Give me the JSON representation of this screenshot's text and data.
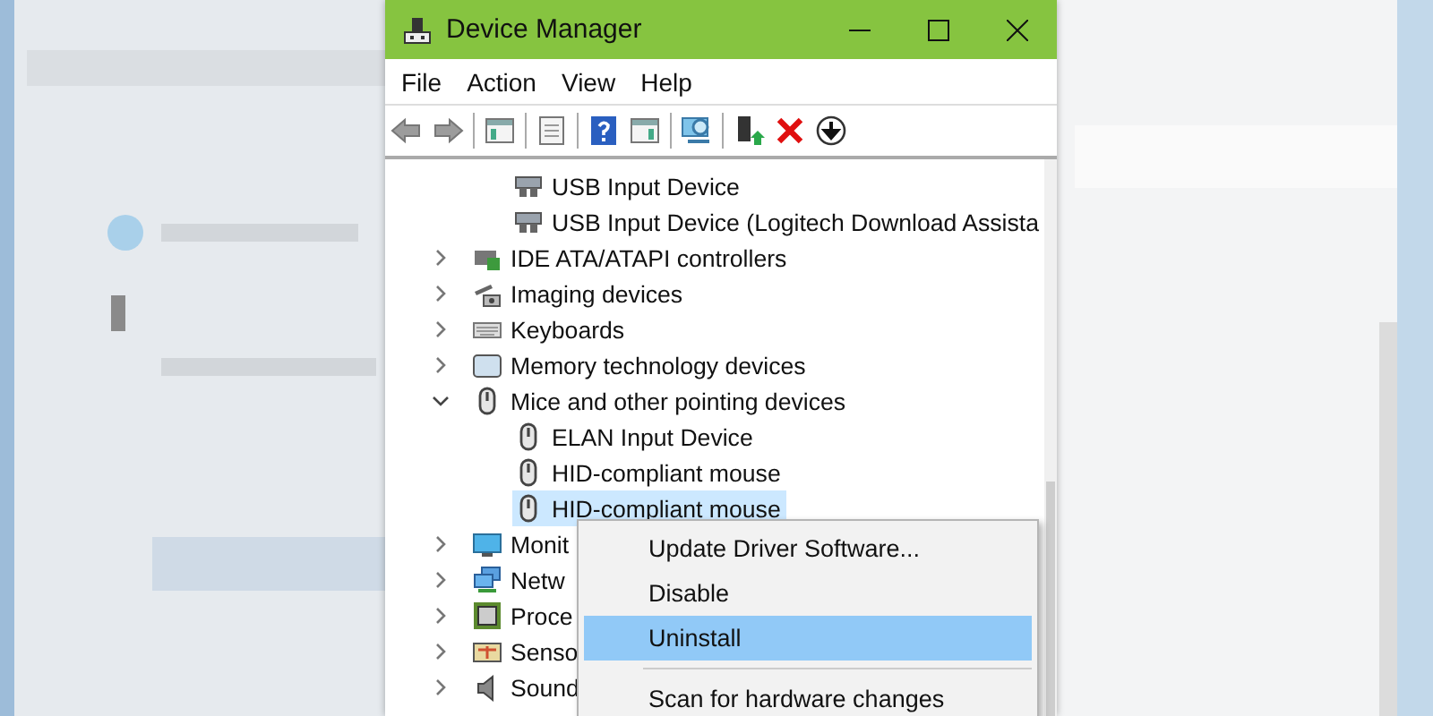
{
  "window": {
    "title": "Device Manager"
  },
  "menu": [
    "File",
    "Action",
    "View",
    "Help"
  ],
  "toolbar": [
    {
      "kind": "back"
    },
    {
      "kind": "forward"
    },
    {
      "kind": "separator"
    },
    {
      "kind": "console"
    },
    {
      "kind": "separator"
    },
    {
      "kind": "properties"
    },
    {
      "kind": "separator"
    },
    {
      "kind": "help"
    },
    {
      "kind": "action_pane"
    },
    {
      "kind": "separator"
    },
    {
      "kind": "scan"
    },
    {
      "kind": "separator"
    },
    {
      "kind": "enable"
    },
    {
      "kind": "uninstall"
    },
    {
      "kind": "update"
    }
  ],
  "tree": {
    "visible_children": [
      {
        "label": "USB Input Device",
        "kind": "usb_keyboard",
        "selected": false
      },
      {
        "label": "USB Input Device (Logitech Download Assista",
        "kind": "usb_keyboard",
        "selected": false
      }
    ],
    "items": [
      {
        "label": "IDE ATA/ATAPI controllers",
        "kind": "ide",
        "expanded": false,
        "selected": false
      },
      {
        "label": "Imaging devices",
        "kind": "camera",
        "expanded": false,
        "selected": false
      },
      {
        "label": "Keyboards",
        "kind": "keyboard",
        "expanded": false,
        "selected": false
      },
      {
        "label": "Memory technology devices",
        "kind": "memory",
        "expanded": false,
        "selected": false
      },
      {
        "label": "Mice and other pointing devices",
        "kind": "mouse",
        "expanded": true,
        "selected": false,
        "children": [
          {
            "label": "ELAN Input Device",
            "kind": "mouse",
            "selected": false
          },
          {
            "label": "HID-compliant mouse",
            "kind": "mouse",
            "selected": false
          },
          {
            "label": "HID-compliant mouse",
            "kind": "mouse",
            "selected": true
          }
        ]
      },
      {
        "label": "Monit",
        "kind": "monitor",
        "expanded": false,
        "selected": false
      },
      {
        "label": "Netw",
        "kind": "network",
        "expanded": false,
        "selected": false
      },
      {
        "label": "Proce",
        "kind": "processor",
        "expanded": false,
        "selected": false
      },
      {
        "label": "Senso",
        "kind": "sensor",
        "expanded": false,
        "selected": false
      },
      {
        "label": "Sound",
        "kind": "speaker",
        "expanded": false,
        "selected": false
      }
    ]
  },
  "context_menu": [
    {
      "kind": "item",
      "label": "Update Driver Software...",
      "selected": false
    },
    {
      "kind": "item",
      "label": "Disable",
      "selected": false
    },
    {
      "kind": "item",
      "label": "Uninstall",
      "selected": true
    },
    {
      "kind": "separator"
    },
    {
      "kind": "item",
      "label": "Scan for hardware changes",
      "selected": false
    }
  ]
}
